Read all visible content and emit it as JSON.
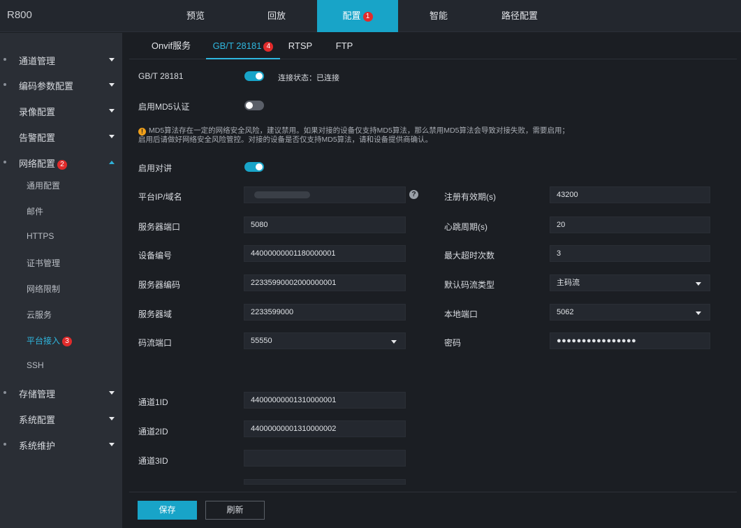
{
  "app": {
    "brand": "R800"
  },
  "topnav": {
    "items": [
      {
        "label": "预览"
      },
      {
        "label": "回放"
      },
      {
        "label": "配置",
        "badge": "1"
      },
      {
        "label": "智能"
      },
      {
        "label": "路径配置"
      }
    ],
    "active": "配置"
  },
  "sidebar": {
    "groups": [
      {
        "label": "通道管理"
      },
      {
        "label": "编码参数配置"
      },
      {
        "label": "录像配置"
      },
      {
        "label": "告警配置"
      },
      {
        "label": "网络配置",
        "badge": "2"
      },
      {
        "label": "存储管理"
      },
      {
        "label": "系统配置"
      },
      {
        "label": "系统维护"
      }
    ],
    "sub_items": [
      {
        "label": "通用配置"
      },
      {
        "label": "邮件"
      },
      {
        "label": "HTTPS"
      },
      {
        "label": "证书管理"
      },
      {
        "label": "网络限制"
      },
      {
        "label": "云服务"
      },
      {
        "label": "平台接入",
        "badge": "3"
      },
      {
        "label": "SSH"
      }
    ]
  },
  "tabs": [
    {
      "label": "Onvif服务"
    },
    {
      "label": "GB/T 28181",
      "badge": "4"
    },
    {
      "label": "RTSP"
    },
    {
      "label": "FTP"
    }
  ],
  "form": {
    "gb_label": "GB/T 28181",
    "gb_enabled": true,
    "connection_status": "连接状态：已连接",
    "md5_label": "启用MD5认证",
    "md5_enabled": false,
    "warning_line1": "MD5算法存在一定的网络安全风险，建议禁用。如果对接的设备仅支持MD5算法，那么禁用MD5算法会导致对接失败，需要启用；",
    "warning_line2": "启用后请做好网络安全风险管控。对接的设备是否仅支持MD5算法，请和设备提供商确认。",
    "intercom_label": "启用对讲",
    "intercom_enabled": true,
    "platform_ip": {
      "label": "平台IP/域名",
      "value": ""
    },
    "server_port": {
      "label": "服务器端口",
      "value": "5080"
    },
    "device_id": {
      "label": "设备编号",
      "value": "44000000001180000001"
    },
    "server_id": {
      "label": "服务器编码",
      "value": "22335990002000000001"
    },
    "server_domain": {
      "label": "服务器域",
      "value": "2233599000"
    },
    "stream_port": {
      "label": "码流端口",
      "value": "55550"
    },
    "reg_validity": {
      "label": "注册有效期(s)",
      "value": "43200"
    },
    "heartbeat": {
      "label": "心跳周期(s)",
      "value": "20"
    },
    "max_timeouts": {
      "label": "最大超时次数",
      "value": "3"
    },
    "default_stream": {
      "label": "默认码流类型",
      "value": "主码流"
    },
    "local_port": {
      "label": "本地端口",
      "value": "5062"
    },
    "password": {
      "label": "密码",
      "value": "●●●●●●●●●●●●●●●●"
    },
    "channels": [
      {
        "label": "通道1ID",
        "value": "44000000001310000001"
      },
      {
        "label": "通道2ID",
        "value": "44000000001310000002"
      },
      {
        "label": "通道3ID",
        "value": ""
      }
    ]
  },
  "buttons": {
    "save": "保存",
    "refresh": "刷新"
  },
  "icons": {
    "help": "help-icon",
    "warning": "warning-icon",
    "caret": "chevron-down-icon"
  },
  "colors": {
    "accent": "#18a4c8",
    "badge": "#e12b2b",
    "warning": "#f0a01a"
  }
}
